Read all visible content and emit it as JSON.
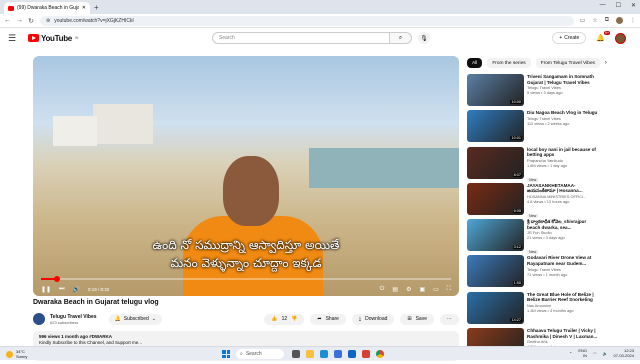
{
  "browser": {
    "tab_title": "(99) Dwaraka Beach in Gujarat...",
    "url": "youtube.com/watch?v=jXGjKZHICkI"
  },
  "youtube": {
    "logo_text": "YouTube",
    "logo_region": "IN",
    "search_placeholder": "Search",
    "create_label": "Create",
    "notif_count": "9+"
  },
  "player": {
    "subtitle_line1": "ఉంది నో సముద్రాన్ని ఆస్వాదిస్తూ అయితే",
    "subtitle_line2": "మనం వెళ్ళున్నాం చూద్దాం ఇక్కడ",
    "time": "0:19 / 8:32",
    "progress_fraction": 0.04
  },
  "video": {
    "title": "Dwaraka Beach in Gujarat telugu vlog",
    "channel_name": "Telugu Travel Vibes",
    "channel_subs": "623 subscribers",
    "subscribed_label": "Subscribed",
    "likes": "12",
    "share_label": "Share",
    "download_label": "Download",
    "save_label": "Save",
    "desc_meta": "596 views  1 month ago  #DWARKA",
    "desc_text": "Kindly Subscribe to this Channel, and Support me..."
  },
  "chips": [
    "All",
    "From the series",
    "From Telugu Travel Vibes"
  ],
  "recommendations": [
    {
      "title": "Triveni Sangamam in Somnath Gujarat | Telugu Travel Vibes",
      "channel": "Telugu Travel Vibes",
      "meta": "5 views • 3 days ago",
      "duration": "10:00",
      "color": "#5b7fa6",
      "new": ""
    },
    {
      "title": "Diu Nagoa Beach Vlog in Telugu",
      "channel": "Telugu Travel Vibes",
      "meta": "112 views • 2 weeks ago",
      "duration": "10:01",
      "color": "#2f7ec4",
      "new": ""
    },
    {
      "title": "local boy nani in jail because of betting apps",
      "channel": "Prapancha Yatrikudu",
      "meta": "1.6M views • 1 day ago",
      "duration": "8:07",
      "color": "#5a2a20",
      "new": "New"
    },
    {
      "title": "JAYASANKHETAMAA-జయసంకేతామా | Hosanna...",
      "channel": "HOSANNA MINISTRIES OFFICI...",
      "meta": "4.8 views • 13 hours ago",
      "duration": "6:05",
      "color": "#7a2a12",
      "new": "New"
    },
    {
      "title": "శ్రీ ద్వారకాధీశ కోవెల_shivrajpur beach dwarka, sea...",
      "channel": "JR Fun Studio",
      "meta": "21 views • 3 days ago",
      "duration": "3:12",
      "color": "#4fa7d8",
      "new": "New"
    },
    {
      "title": "Godavari River Drone View at Rayapatnam near Gudem...",
      "channel": "Telugu Travel Vibes",
      "meta": "71 views • 1 month ago",
      "duration": "1:50",
      "color": "#3c7bbd",
      "new": ""
    },
    {
      "title": "The Great Blue Hole of Belize | Belize Barrier Reef Snorkeling",
      "channel": "Nas Amrosine",
      "meta": "1.3M views • 4 months ago",
      "duration": "14:27",
      "color": "#2a6fa8",
      "new": ""
    },
    {
      "title": "Chhaava Telugu Trailer | Vicky | Rashmika | Dinesh V | Laxman...",
      "channel": "Geetha Arts",
      "meta": "4.3M views • 4 days ago",
      "duration": "2:39",
      "color": "#8b3a1a",
      "new": ""
    }
  ],
  "taskbar": {
    "search_placeholder": "Search",
    "weather_temp": "34°C",
    "weather_desc": "Sunny",
    "lang": "ENG",
    "region": "IN",
    "time": "12:23",
    "date": "07-03-2024"
  }
}
